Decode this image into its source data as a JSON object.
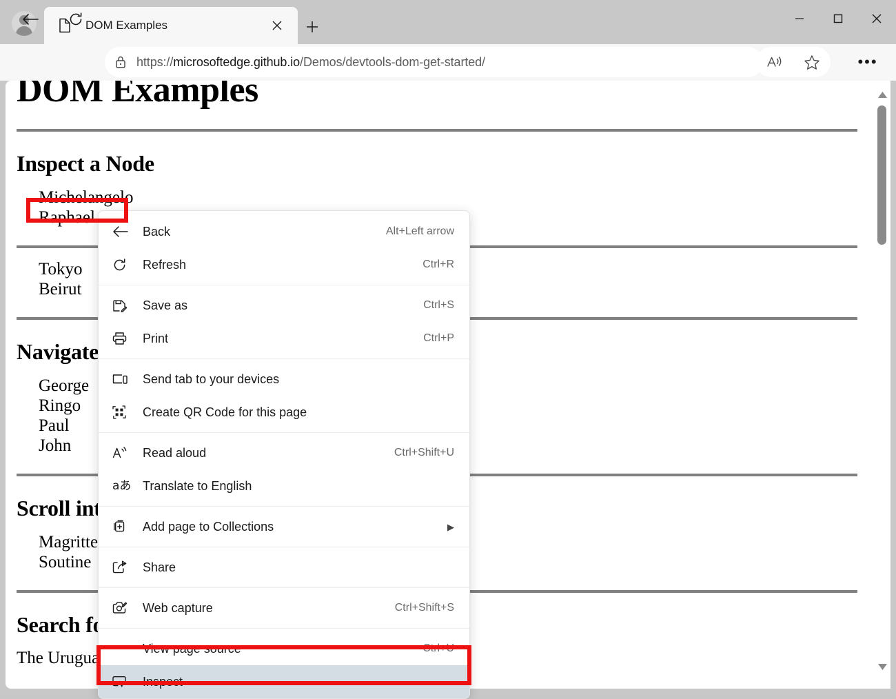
{
  "window": {
    "controls": [
      {
        "name": "minimize",
        "glyph": "─"
      },
      {
        "name": "maximize",
        "glyph": "□"
      },
      {
        "name": "close",
        "glyph": "✕"
      }
    ]
  },
  "tabstrip": {
    "profile_label": "profile-avatar",
    "tab": {
      "title": "DOM Examples",
      "favicon": "page-icon",
      "close_label": "✕"
    },
    "new_tab_label": "+"
  },
  "navbar": {
    "back_label": "←",
    "refresh_label": "refresh",
    "url": {
      "scheme": "https://",
      "host": "microsoftedge.github.io",
      "path": "/Demos/devtools-dom-get-started/",
      "full": "https://microsoftedge.github.io/Demos/devtools-dom-get-started/"
    },
    "lock_icon": "lock-icon",
    "read_aloud_label": "read-aloud",
    "favorites_label": "favorites-star",
    "settings_label": "•••"
  },
  "page": {
    "title": "DOM Examples",
    "sections": [
      {
        "heading": "Inspect a Node",
        "items": [
          "Michelangelo",
          "Raphael"
        ]
      },
      {
        "heading": "",
        "items": [
          "Tokyo",
          "Beirut"
        ]
      },
      {
        "heading": "Navigate the DOM tree",
        "items": [
          "George",
          "Ringo",
          "Paul",
          "John"
        ]
      },
      {
        "heading": "Scroll into view",
        "items": [
          "Magritte",
          "Soutine"
        ]
      },
      {
        "heading": "Search for nodes",
        "items": []
      }
    ],
    "search_intro": "The Uruguayan writer Juan Carlos Wister"
  },
  "scrollbar": {
    "up_glyph": "▲",
    "down_glyph": "▼"
  },
  "context_menu": {
    "items": [
      {
        "label": "Back",
        "accel": "Alt+Left arrow",
        "icon": "back-arrow-icon",
        "indent": false,
        "highlight": false,
        "submenu": false
      },
      {
        "label": "Refresh",
        "accel": "Ctrl+R",
        "icon": "refresh-icon",
        "indent": false,
        "highlight": false,
        "submenu": false
      },
      {
        "sep": true
      },
      {
        "label": "Save as",
        "accel": "Ctrl+S",
        "icon": "save-icon",
        "indent": false,
        "highlight": false,
        "submenu": false
      },
      {
        "label": "Print",
        "accel": "Ctrl+P",
        "icon": "print-icon",
        "indent": false,
        "highlight": false,
        "submenu": false
      },
      {
        "sep": true
      },
      {
        "label": "Send tab to your devices",
        "accel": "",
        "icon": "devices-icon",
        "indent": false,
        "highlight": false,
        "submenu": false
      },
      {
        "label": "Create QR Code for this page",
        "accel": "",
        "icon": "qr-code-icon",
        "indent": false,
        "highlight": false,
        "submenu": false
      },
      {
        "sep": true
      },
      {
        "label": "Read aloud",
        "accel": "Ctrl+Shift+U",
        "icon": "read-aloud-icon",
        "indent": false,
        "highlight": false,
        "submenu": false
      },
      {
        "label": "Translate to English",
        "accel": "",
        "icon": "translate-icon",
        "indent": false,
        "highlight": false,
        "submenu": false
      },
      {
        "sep": true
      },
      {
        "label": "Add page to Collections",
        "accel": "",
        "icon": "collections-icon",
        "indent": false,
        "highlight": false,
        "submenu": true
      },
      {
        "sep": true
      },
      {
        "label": "Share",
        "accel": "",
        "icon": "share-icon",
        "indent": false,
        "highlight": false,
        "submenu": false
      },
      {
        "sep": true
      },
      {
        "label": "Web capture",
        "accel": "Ctrl+Shift+S",
        "icon": "web-capture-icon",
        "indent": false,
        "highlight": false,
        "submenu": false
      },
      {
        "sep": true
      },
      {
        "label": "View page source",
        "accel": "Ctrl+U",
        "icon": "",
        "indent": true,
        "highlight": false,
        "submenu": false
      },
      {
        "label": "Inspect",
        "accel": "",
        "icon": "inspect-icon",
        "indent": false,
        "highlight": true,
        "submenu": false
      }
    ]
  },
  "annotations": {
    "node_box": "Michelangelo",
    "inspect_box": "Inspect",
    "color": "#ee1111"
  },
  "colors": {
    "tabstrip_bg": "#c8c8c8",
    "toolbar_bg": "#f7f7f7",
    "page_bg": "#ffffff",
    "menu_highlight": "#d4dde4",
    "annotation_red": "#ee1111",
    "scrollbar_thumb": "#8a8a8a",
    "rule_gray": "#808080"
  }
}
